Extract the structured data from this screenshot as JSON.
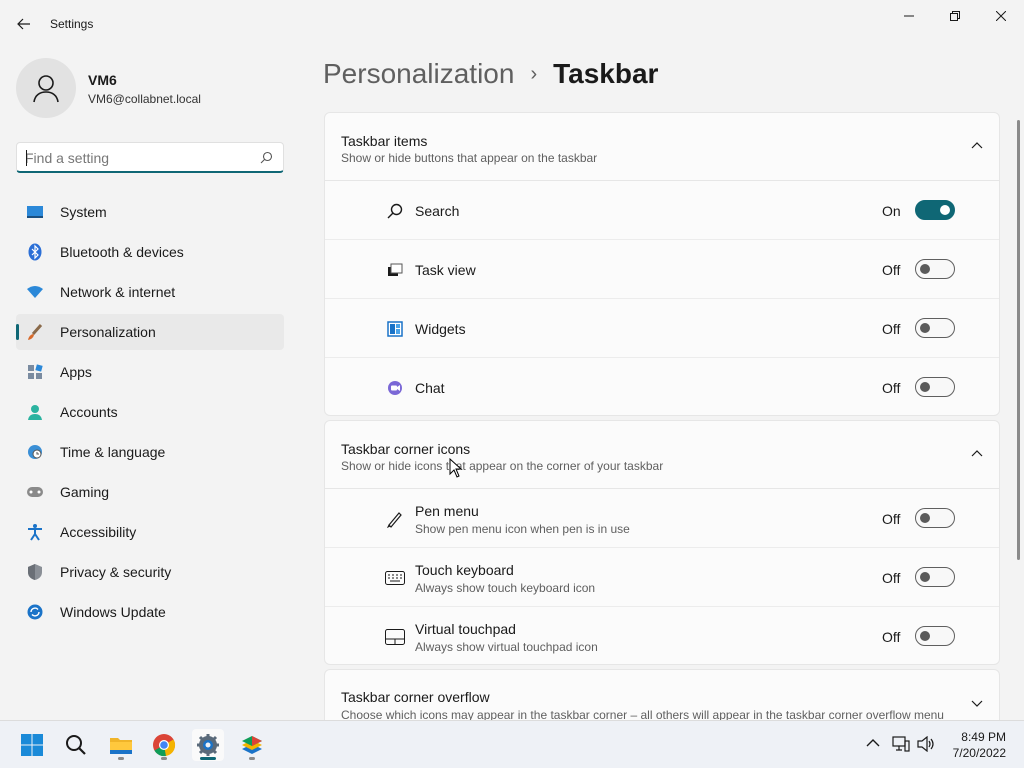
{
  "window": {
    "title": "Settings"
  },
  "user": {
    "name": "VM6",
    "email": "VM6@collabnet.local"
  },
  "search": {
    "placeholder": "Find a setting"
  },
  "sidebar": {
    "items": [
      {
        "label": "System",
        "icon": "system-icon",
        "active": false
      },
      {
        "label": "Bluetooth & devices",
        "icon": "bluetooth-icon",
        "active": false
      },
      {
        "label": "Network & internet",
        "icon": "wifi-icon",
        "active": false
      },
      {
        "label": "Personalization",
        "icon": "brush-icon",
        "active": true
      },
      {
        "label": "Apps",
        "icon": "apps-icon",
        "active": false
      },
      {
        "label": "Accounts",
        "icon": "accounts-icon",
        "active": false
      },
      {
        "label": "Time & language",
        "icon": "clock-globe-icon",
        "active": false
      },
      {
        "label": "Gaming",
        "icon": "gamepad-icon",
        "active": false
      },
      {
        "label": "Accessibility",
        "icon": "accessibility-icon",
        "active": false
      },
      {
        "label": "Privacy & security",
        "icon": "shield-icon",
        "active": false
      },
      {
        "label": "Windows Update",
        "icon": "update-icon",
        "active": false
      }
    ]
  },
  "breadcrumb": {
    "parent": "Personalization",
    "separator": "›",
    "current": "Taskbar"
  },
  "taskbar_items": {
    "title": "Taskbar items",
    "subtitle": "Show or hide buttons that appear on the taskbar",
    "rows": [
      {
        "label": "Search",
        "state": "On",
        "on": true,
        "icon": "search-icon"
      },
      {
        "label": "Task view",
        "state": "Off",
        "on": false,
        "icon": "task-view-icon"
      },
      {
        "label": "Widgets",
        "state": "Off",
        "on": false,
        "icon": "widgets-icon"
      },
      {
        "label": "Chat",
        "state": "Off",
        "on": false,
        "icon": "chat-icon"
      }
    ]
  },
  "corner_icons": {
    "title": "Taskbar corner icons",
    "subtitle": "Show or hide icons that appear on the corner of your taskbar",
    "rows": [
      {
        "label": "Pen menu",
        "desc": "Show pen menu icon when pen is in use",
        "state": "Off",
        "on": false,
        "icon": "pen-icon"
      },
      {
        "label": "Touch keyboard",
        "desc": "Always show touch keyboard icon",
        "state": "Off",
        "on": false,
        "icon": "keyboard-icon"
      },
      {
        "label": "Virtual touchpad",
        "desc": "Always show virtual touchpad icon",
        "state": "Off",
        "on": false,
        "icon": "touchpad-icon"
      }
    ]
  },
  "corner_overflow": {
    "title": "Taskbar corner overflow",
    "subtitle": "Choose which icons may appear in the taskbar corner – all others will appear in the taskbar corner overflow menu"
  },
  "clock": {
    "time": "8:49 PM",
    "date": "7/20/2022"
  },
  "colors": {
    "accent": "#0f6775"
  }
}
